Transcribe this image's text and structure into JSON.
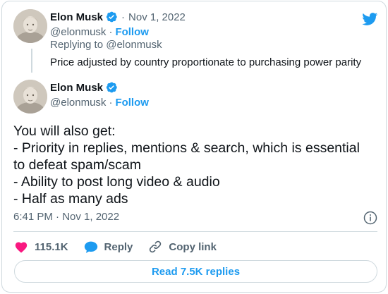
{
  "parent_tweet": {
    "author_name": "Elon Musk",
    "handle": "@elonmusk",
    "separator": "·",
    "date": "Nov 1, 2022",
    "follow_label": "Follow",
    "replying_to": "Replying to @elonmusk",
    "text": "Price adjusted by country proportionate to purchasing power parity"
  },
  "main_tweet": {
    "author_name": "Elon Musk",
    "handle": "@elonmusk",
    "separator": "·",
    "follow_label": "Follow",
    "text_lines": [
      "You will also get:",
      "- Priority in replies, mentions & search, which is essential",
      "to defeat spam/scam",
      "- Ability to post long video & audio",
      "- Half as many ads"
    ],
    "timestamp": "6:41 PM · Nov 1, 2022"
  },
  "actions": {
    "likes": "115.1K",
    "reply_label": "Reply",
    "copy_link_label": "Copy link"
  },
  "read_replies_label": "Read 7.5K replies",
  "icons": {
    "brand": "twitter-bird-icon",
    "verified": "verified-badge-icon",
    "info": "info-icon",
    "like": "heart-icon",
    "reply": "speech-bubble-icon",
    "link": "link-icon"
  },
  "colors": {
    "accent": "#1d9bf0",
    "like": "#f91880",
    "muted_text": "#536471",
    "border": "#cfd9de"
  }
}
